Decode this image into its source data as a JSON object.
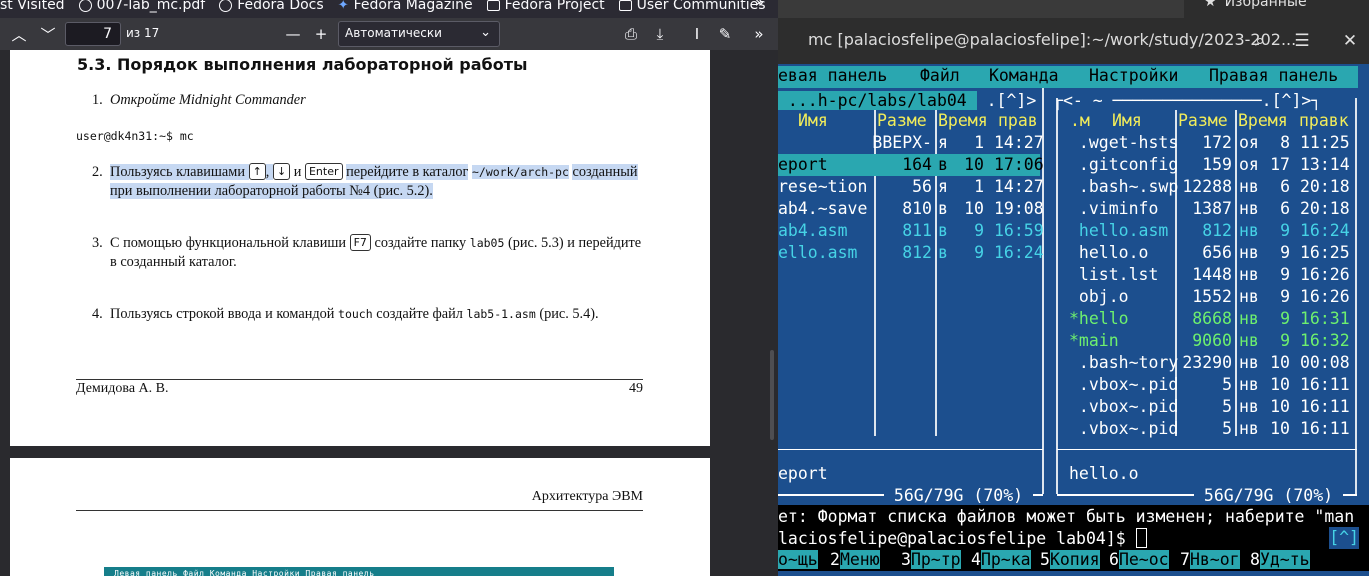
{
  "bookmarks": [
    {
      "label": "st Visited",
      "icon": ""
    },
    {
      "label": "007-lab_mc.pdf",
      "icon": "globe-icon"
    },
    {
      "label": "Fedora Docs",
      "icon": "globe-icon"
    },
    {
      "label": "Fedora Magazine",
      "icon": "fedora-icon"
    },
    {
      "label": "Fedora Project",
      "icon": "folder-icon"
    },
    {
      "label": "User Communities",
      "icon": "folder-icon"
    }
  ],
  "pdf_toolbar": {
    "page_number": "7",
    "page_of": "из 17",
    "zoom_value": "Автоматически"
  },
  "page7": {
    "section_title": "5.3.  Порядок выполнения лабораторной работы",
    "item1_num": "1.",
    "item1_text": "Откройте Midnight Commander",
    "command_line": "user@dk4n31:~$ mc",
    "item2_num": "2.",
    "item2_a": "Пользуясь клавишами",
    "key_up": "↑",
    "key_down": "↓",
    "item2_and": "и",
    "key_enter": "Enter",
    "item2_b": "перейдите в каталог",
    "item2_path": "~/work/arch-pc",
    "item2_c": "созданный",
    "item2_d": "при выполнении лабораторной работы №4 (рис. 5.2).",
    "item3_num": "3.",
    "item3_a": "С помощью функциональной клавиши",
    "key_f7": "F7",
    "item3_b": "создайте папку",
    "item3_dir": "lab05",
    "item3_c": "(рис. 5.3) и перейдите",
    "item3_d": "в созданный каталог.",
    "item4_num": "4.",
    "item4_a": "Пользуясь строкой ввода и командой",
    "item4_cmd": "touch",
    "item4_b": "создайте файл",
    "item4_file": "lab5-1.asm",
    "item4_c": "(рис. 5.4).",
    "footer_author": "Демидова А. В.",
    "footer_page": "49"
  },
  "page8": {
    "header": "Архитектура ЭВМ",
    "thumb_menu": "Левая панель    Файл    Команда    Настройки    Правая панель"
  },
  "terminal": {
    "title": "mc [palaciosfelipe@palaciosfelipe]:~/work/study/2023-202...",
    "favorites": "Избранные"
  },
  "mc": {
    "menu": [
      "евая панель",
      "Файл",
      "Команда",
      "Настройки",
      "Правая панель"
    ],
    "left_path": " ...h-pc/labs/lab04 ",
    "left_brackets": ".[^]>",
    "right_path": "<- ~",
    "right_brackets": ".[^]>",
    "cols_left": {
      "name": "Имя",
      "size": "Разме",
      "time": "Время",
      "perm": "прав"
    },
    "cols_right": {
      "mark": ".м",
      "name": "Имя",
      "size": "Разме",
      "time": "Время",
      "perm": "правк"
    },
    "left_files": [
      {
        "name": "",
        "size": "ВВЕРХ-",
        "m": "я",
        "d": "1",
        "t": "14:27",
        "cls": ""
      },
      {
        "name": "eport",
        "size": "164",
        "m": "в",
        "d": "10",
        "t": "17:06",
        "cls": "sel"
      },
      {
        "name": "rese~tion",
        "size": "56",
        "m": "я",
        "d": "1",
        "t": "14:27",
        "cls": ""
      },
      {
        "name": "ab4.~save",
        "size": "810",
        "m": "в",
        "d": "10",
        "t": "19:08",
        "cls": ""
      },
      {
        "name": "ab4.asm",
        "size": "811",
        "m": "в",
        "d": "9",
        "t": "16:59",
        "cls": "cyan"
      },
      {
        "name": "ello.asm",
        "size": "812",
        "m": "в",
        "d": "9",
        "t": "16:24",
        "cls": "cyan"
      }
    ],
    "right_files": [
      {
        "name": " .wget-hsts",
        "size": "172",
        "m": "оя",
        "d": "8",
        "t": "11:25",
        "cls": ""
      },
      {
        "name": " .gitconfig",
        "size": "159",
        "m": "оя",
        "d": "17",
        "t": "13:14",
        "cls": ""
      },
      {
        "name": " .bash~.swp",
        "size": "12288",
        "m": "нв",
        "d": "6",
        "t": "20:18",
        "cls": ""
      },
      {
        "name": " .viminfo",
        "size": "1387",
        "m": "нв",
        "d": "6",
        "t": "20:18",
        "cls": ""
      },
      {
        "name": " hello.asm",
        "size": "812",
        "m": "нв",
        "d": "9",
        "t": "16:24",
        "cls": "cyan"
      },
      {
        "name": " hello.o",
        "size": "656",
        "m": "нв",
        "d": "9",
        "t": "16:25",
        "cls": ""
      },
      {
        "name": " list.lst",
        "size": "1448",
        "m": "нв",
        "d": "9",
        "t": "16:26",
        "cls": ""
      },
      {
        "name": " obj.o",
        "size": "1552",
        "m": "нв",
        "d": "9",
        "t": "16:26",
        "cls": ""
      },
      {
        "name": "*hello",
        "size": "8668",
        "m": "нв",
        "d": "9",
        "t": "16:31",
        "cls": "green"
      },
      {
        "name": "*main",
        "size": "9060",
        "m": "нв",
        "d": "9",
        "t": "16:32",
        "cls": "green"
      },
      {
        "name": " .bash~tory",
        "size": "23290",
        "m": "нв",
        "d": "10",
        "t": "00:08",
        "cls": ""
      },
      {
        "name": " .vbox~.pid",
        "size": "5",
        "m": "нв",
        "d": "10",
        "t": "16:11",
        "cls": ""
      },
      {
        "name": " .vbox~.pid",
        "size": "5",
        "m": "нв",
        "d": "10",
        "t": "16:11",
        "cls": ""
      },
      {
        "name": " .vbox~.pid",
        "size": "5",
        "m": "нв",
        "d": "10",
        "t": "16:11",
        "cls": ""
      }
    ],
    "left_status": "eport",
    "right_status": "hello.o",
    "left_disk": " 56G/79G (70%) ",
    "right_disk": " 56G/79G (70%) ",
    "hint": "ет: Формат списка файлов может быть изменен; наберите \"man",
    "prompt": "laciosfelipe@palaciosfelipe lab04]$ ",
    "up_hint": "[^]",
    "fkeys": [
      {
        "num": "",
        "lab": "о~щь"
      },
      {
        "num": "2",
        "lab": "Меню"
      },
      {
        "num": "3",
        "lab": "Пр~тр"
      },
      {
        "num": "4",
        "lab": "Пр~ка"
      },
      {
        "num": "5",
        "lab": "Копия"
      },
      {
        "num": "6",
        "lab": "Пе~ос"
      },
      {
        "num": "7",
        "lab": "Нв~ог"
      },
      {
        "num": "8",
        "lab": "Уд~ть"
      }
    ]
  }
}
